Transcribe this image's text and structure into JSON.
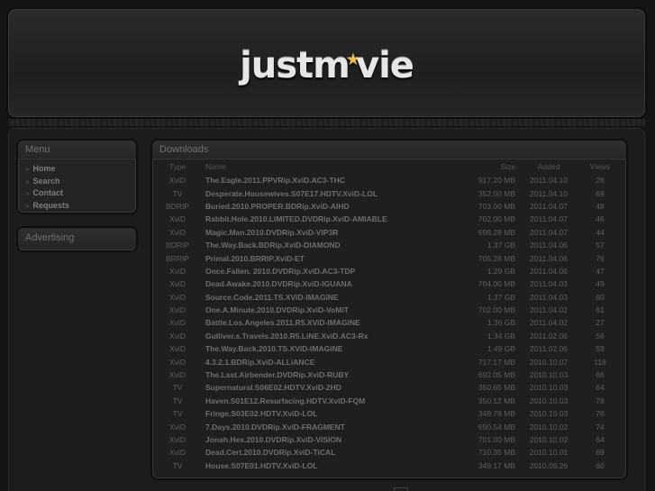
{
  "header": {
    "logo_text_before": "justm",
    "logo_text_after": "vie"
  },
  "sidebar": {
    "menu_title": "Menu",
    "menu_items": [
      "Home",
      "Search",
      "Contact",
      "Requests"
    ],
    "advertising_title": "Advertising"
  },
  "downloads": {
    "title": "Downloads",
    "columns": {
      "type": "Type",
      "name": "Name",
      "size": "Size",
      "added": "Added",
      "views": "Views"
    },
    "rows": [
      {
        "type": "XviD",
        "name": "The.Eagle.2011.PPVRip.XviD.AC3-THC",
        "size": "917.20 MB",
        "added": "2011.04.10",
        "views": "28"
      },
      {
        "type": "TV",
        "name": "Desperate.Housewives.S07E17.HDTV.XviD-LOL",
        "size": "352.00 MB",
        "added": "2011.04.10",
        "views": "69"
      },
      {
        "type": "BDRIP",
        "name": "Buried.2010.PROPER.BDRip.XviD-AIHD",
        "size": "703.00 MB",
        "added": "2011.04.07",
        "views": "48"
      },
      {
        "type": "XviD",
        "name": "Rabbit.Hole.2010.LIMITED.DVDRip.XviD-AMIABLE",
        "size": "702.00 MB",
        "added": "2011.04.07",
        "views": "46"
      },
      {
        "type": "XviD",
        "name": "Magic.Man.2010.DVDRip.XviD-VIP3R",
        "size": "698.28 MB",
        "added": "2011.04.07",
        "views": "44"
      },
      {
        "type": "BDRIP",
        "name": "The.Way.Back.BDRip.XviD-DIAMOND",
        "size": "1.37 GB",
        "added": "2011.04.06",
        "views": "57"
      },
      {
        "type": "BRRIP",
        "name": "Primal.2010.BRRIP.XviD-ET",
        "size": "705.28 MB",
        "added": "2011.04.06",
        "views": "76"
      },
      {
        "type": "XviD",
        "name": "Once.Fallen. 2010.DVDRip.XviD.AC3-TDP",
        "size": "1.29 GB",
        "added": "2011.04.06",
        "views": "47"
      },
      {
        "type": "XviD",
        "name": "Dead.Awake.2010.DVDRip.XviD-IGUANA",
        "size": "704.00 MB",
        "added": "2011.04.03",
        "views": "49"
      },
      {
        "type": "XviD",
        "name": "Source.Code.2011.TS.XViD-IMAGiNE",
        "size": "1.37 GB",
        "added": "2011.04.03",
        "views": "60"
      },
      {
        "type": "XviD",
        "name": "One.A.Minute.2010.DVDRip.XviD-VoMiT",
        "size": "702.00 MB",
        "added": "2011.04.02",
        "views": "61"
      },
      {
        "type": "XviD",
        "name": "Battle.Los.Angeles.2011.R5.XViD-IMAGiNE",
        "size": "1.36 GB",
        "added": "2011.04.02",
        "views": "27"
      },
      {
        "type": "XviD",
        "name": "Gulliver.s.Travels.2010.R5.LiNE.XviD.AC3-Rx",
        "size": "1.34 GB",
        "added": "2011.02.06",
        "views": "56"
      },
      {
        "type": "XviD",
        "name": "The.Way.Back.2010.TS.XViD-IMAGiNE",
        "size": "1.49 GB",
        "added": "2011.02.06",
        "views": "59"
      },
      {
        "type": "XviD",
        "name": "4.3.2.1.BDRip.XviD-ALLiANCE",
        "size": "717.17 MB",
        "added": "2010.10.07",
        "views": "118"
      },
      {
        "type": "XviD",
        "name": "The.Last.Airbender.DVDRip.XviD-RUBY",
        "size": "692.05 MB",
        "added": "2010.10.03",
        "views": "66"
      },
      {
        "type": "TV",
        "name": "Supernatural.S06E02.HDTV.XviD-2HD",
        "size": "350.65 MB",
        "added": "2010.10.03",
        "views": "64"
      },
      {
        "type": "TV",
        "name": "Haven.S01E12.Resurfacing.HDTV.XviD-FQM",
        "size": "350.12 MB",
        "added": "2010.10.03",
        "views": "78"
      },
      {
        "type": "TV",
        "name": "Fringe.S03E02.HDTV.XviD-LOL",
        "size": "349.78 MB",
        "added": "2010.10.03",
        "views": "76"
      },
      {
        "type": "XviD",
        "name": "7.Days.2010.DVDRip.XviD-FRAGMENT",
        "size": "690.54 MB",
        "added": "2010.10.02",
        "views": "74"
      },
      {
        "type": "XviD",
        "name": "Jonah.Hex.2010.DVDRip.XviD-VISION",
        "size": "701.00 MB",
        "added": "2010.10.02",
        "views": "64"
      },
      {
        "type": "XviD",
        "name": "Dead.Cert.2010.DVDRip.XviD-TiCAL",
        "size": "710.35 MB",
        "added": "2010.10.01",
        "views": "69"
      },
      {
        "type": "TV",
        "name": "House.S07E01.HDTV.XviD-LOL",
        "size": "349.17 MB",
        "added": "2010.09.26",
        "views": "60"
      }
    ]
  }
}
